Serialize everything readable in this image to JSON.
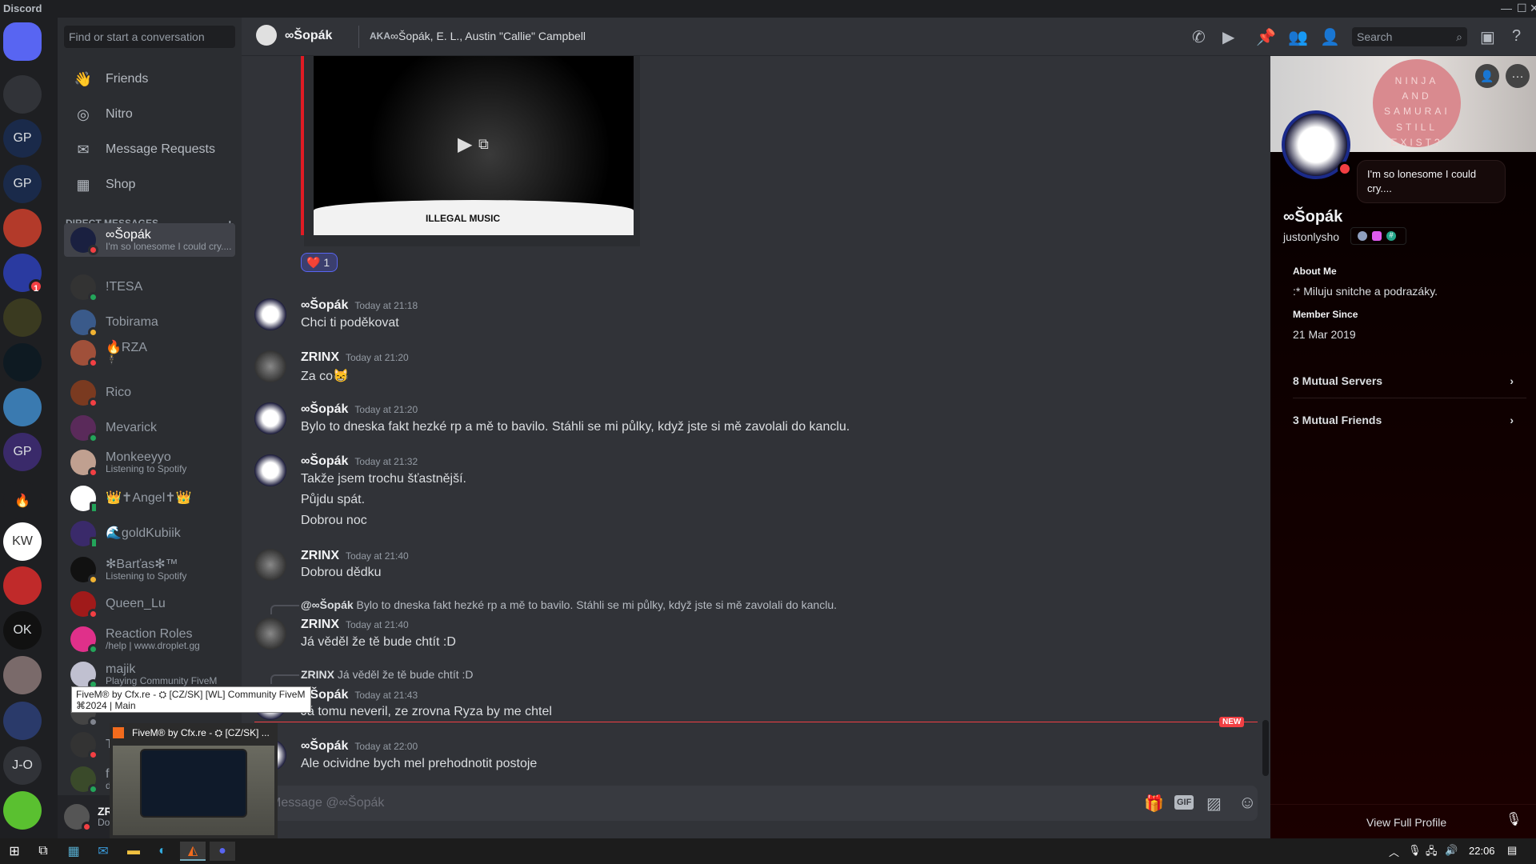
{
  "app": {
    "title": "Discord"
  },
  "rail": {
    "servers": [
      {
        "label": "",
        "color": "#5865f2",
        "icon": "discord-logo-icon"
      },
      {
        "label": "",
        "color": "#313338",
        "icon": "folder-icon"
      },
      {
        "label": "GP",
        "color": "#1a2a4a"
      },
      {
        "label": "GP",
        "color": "#1a2a4a"
      },
      {
        "label": "",
        "color": "#b33a2a"
      },
      {
        "label": "",
        "color": "#2a3aa0",
        "badge": "1"
      },
      {
        "label": "",
        "color": "#3a3a20"
      },
      {
        "label": "",
        "color": "#0e1a22"
      },
      {
        "label": "",
        "color": "#3a7ab0"
      },
      {
        "label": "GP",
        "color": "#3a2a6a"
      },
      {
        "label": "🔥",
        "color": "#1e1f22"
      },
      {
        "label": "KW",
        "color": "#ffffff"
      },
      {
        "label": "",
        "color": "#c02a2a"
      },
      {
        "label": "OK",
        "color": "#111111"
      },
      {
        "label": "",
        "color": "#7a6a6a"
      },
      {
        "label": "",
        "color": "#2a3a6a"
      },
      {
        "label": "J-O",
        "color": "#313338"
      },
      {
        "label": "",
        "color": "#5ac030"
      }
    ]
  },
  "sidebar": {
    "search_placeholder": "Find or start a conversation",
    "nav": [
      {
        "label": "Friends",
        "icon": "friends-icon"
      },
      {
        "label": "Nitro",
        "icon": "nitro-icon"
      },
      {
        "label": "Message Requests",
        "icon": "envelope-icon"
      },
      {
        "label": "Shop",
        "icon": "shop-icon"
      }
    ],
    "dm_header": "DIRECT MESSAGES",
    "dm_add": "+",
    "dms": [
      {
        "name": "∞Šopák",
        "sub": "I'm so lonesome I could cry....",
        "status": "dnd",
        "selected": true,
        "color": "#1a2040"
      },
      {
        "name": "!TESA",
        "sub": "",
        "status": "online",
        "color": "#333"
      },
      {
        "name": "Tobirama",
        "sub": "",
        "status": "idle",
        "color": "#3a5a8a"
      },
      {
        "name": "🔥RZA",
        "sub": "🕴",
        "status": "dnd",
        "color": "#a0503a"
      },
      {
        "name": "Rico",
        "sub": "",
        "status": "dnd",
        "color": "#7a3a20"
      },
      {
        "name": "Mevarick",
        "sub": "",
        "status": "online",
        "color": "#5a2a5a"
      },
      {
        "name": "Monkeeyyo",
        "sub": "Listening to Spotify",
        "status": "dnd",
        "color": "#c0a090"
      },
      {
        "name": "👑✝Angel✝👑",
        "sub": "",
        "status": "mobile",
        "color": "#ffffff"
      },
      {
        "name": "🌊goldKubiik",
        "sub": "",
        "status": "mobile",
        "color": "#3a2a6a"
      },
      {
        "name": "✻Barťas✻™",
        "sub": "Listening to Spotify",
        "status": "idle",
        "color": "#111"
      },
      {
        "name": "Queen_Lu",
        "sub": "",
        "status": "dnd",
        "color": "#a01a1a"
      },
      {
        "name": "Reaction Roles",
        "sub": "/help | www.droplet.gg",
        "status": "online",
        "color": "#e0308a"
      },
      {
        "name": "majik",
        "sub": "Playing Community FiveM",
        "status": "online",
        "color": "#c0c0d0"
      },
      {
        "name": "",
        "sub": "",
        "status": "offline",
        "color": "#444"
      },
      {
        "name": "T",
        "sub": "",
        "status": "dnd",
        "color": "#333"
      },
      {
        "name": "fi",
        "sub": "di",
        "status": "online",
        "color": "#3a4a2a"
      }
    ],
    "user": {
      "name": "ZRI",
      "status": "Do N"
    }
  },
  "header": {
    "name": "∞Šopák",
    "aka_label": "AKA",
    "aka": "∞Šopák, E. L., Austin \"Callie\" Campbell",
    "search_placeholder": "Search"
  },
  "embed": {
    "label": "ILLEGAL MUSIC"
  },
  "reaction": {
    "emoji": "❤️",
    "count": "1"
  },
  "messages": [
    {
      "author": "∞Šopák",
      "time": "Today at 21:18",
      "lines": [
        "Chci ti poděkovat"
      ],
      "avatar": "sopak"
    },
    {
      "author": "ZRINX",
      "time": "Today at 21:20",
      "lines": [
        "Za co😸"
      ],
      "avatar": "zrinx"
    },
    {
      "author": "∞Šopák",
      "time": "Today at 21:20",
      "lines": [
        "Bylo to dneska fakt hezké rp a mě to bavilo. Stáhli se mi půlky, když jste si mě zavolali do kanclu."
      ],
      "avatar": "sopak"
    },
    {
      "author": "∞Šopák",
      "time": "Today at 21:32",
      "lines": [
        "Takže jsem trochu šťastnější.",
        "Půjdu spát.",
        "Dobrou noc"
      ],
      "avatar": "sopak"
    },
    {
      "author": "ZRINX",
      "time": "Today at 21:40",
      "lines": [
        "Dobrou dědku"
      ],
      "avatar": "zrinx"
    },
    {
      "reply_author": "@∞Šopák",
      "reply_text": "Bylo to dneska fakt hezké rp a mě to bavilo. Stáhli se mi půlky, když jste si mě zavolali do kanclu.",
      "author": "ZRINX",
      "time": "Today at 21:40",
      "lines": [
        "Já věděl že tě bude chtít :D"
      ],
      "avatar": "zrinx"
    },
    {
      "reply_author": "ZRINX",
      "reply_text": "Já věděl že tě bude chtít :D",
      "author": "∞Šopák",
      "time": "Today at 21:43",
      "lines": [
        "Já tomu neveril, ze zrovna Ryza by me chtel"
      ],
      "avatar": "sopak"
    },
    {
      "author": "∞Šopák",
      "time": "Today at 22:00",
      "lines": [
        "Ale ocividne bych mel prehodnotit postoje"
      ],
      "avatar": "sopak"
    }
  ],
  "new_label": "NEW",
  "composer": {
    "placeholder": "Message @∞Šopák",
    "gif": "GIF"
  },
  "profile": {
    "banner_text": "NINJA AND SAMURAI STILL EXIST?",
    "status": "I'm so lonesome I could cry....",
    "name": "∞Šopák",
    "username": "justonlysho",
    "about_label": "About Me",
    "about": ":* Miluju snitche a podrazáky.",
    "member_label": "Member Since",
    "member_since": "21 Mar 2019",
    "mutual_servers": "8 Mutual Servers",
    "mutual_friends": "3 Mutual Friends",
    "view_full": "View Full Profile"
  },
  "tooltip": {
    "line1": "FiveM® by Cfx.re - ⛭ [CZ/SK] [WL] Community FiveM",
    "line2": "⌘2024 | Main"
  },
  "thumbnail": {
    "title": "FiveM® by Cfx.re - ⛭ [CZ/SK] ..."
  },
  "taskbar": {
    "clock": "22:06"
  },
  "colors": {
    "accent": "#5865f2",
    "dnd": "#f23f43",
    "online": "#23a55a",
    "idle": "#f0b232",
    "offline": "#80848e",
    "new": "#f23f43"
  }
}
